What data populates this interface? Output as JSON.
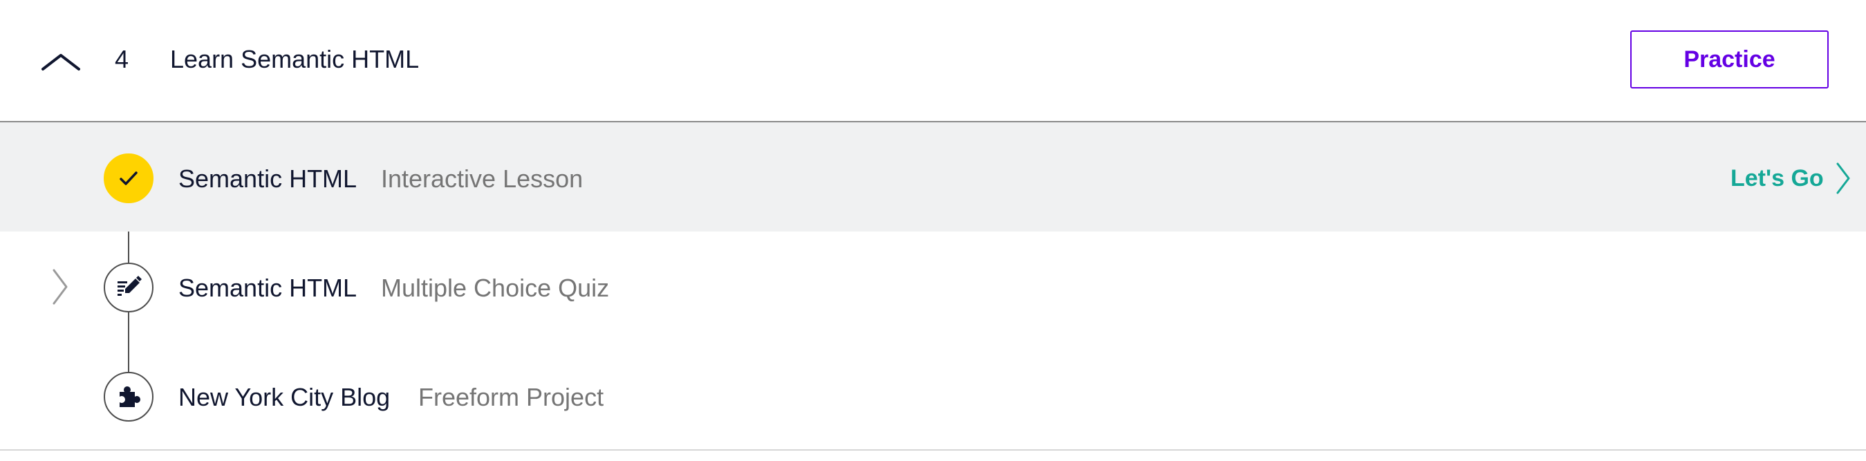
{
  "module": {
    "number": "4",
    "title": "Learn Semantic HTML",
    "practice_label": "Practice"
  },
  "items": [
    {
      "title": "Semantic HTML",
      "type": "Interactive Lesson",
      "status": "completed",
      "icon": "check-icon",
      "action_label": "Let's Go"
    },
    {
      "title": "Semantic HTML",
      "type": "Multiple Choice Quiz",
      "status": "not-started",
      "icon": "quiz-pencil-icon"
    },
    {
      "title": "New York City Blog",
      "type": "Freeform Project",
      "status": "not-started",
      "icon": "puzzle-piece-icon"
    }
  ],
  "colors": {
    "accent_purple": "#6400e4",
    "accent_teal": "#15a897",
    "completed_yellow": "#ffd300",
    "active_row_bg": "#f0f1f2"
  }
}
